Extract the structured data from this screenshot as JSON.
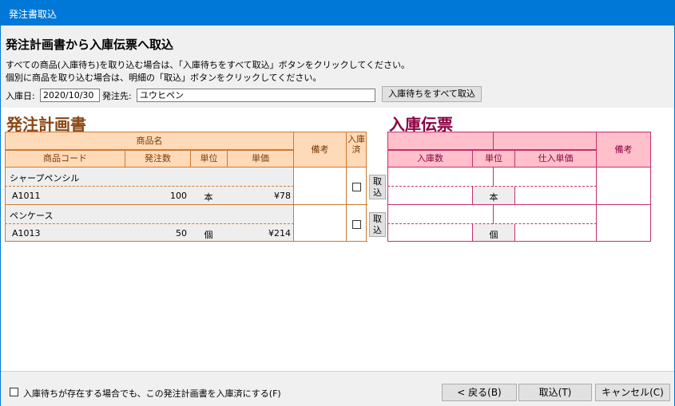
{
  "window": {
    "title": "発注書取込"
  },
  "header": {
    "heading": "発注計画書から入庫伝票へ取込",
    "desc1": "すべての商品(入庫待ち)を取り込む場合は、「入庫待ちをすべて取込」ボタンをクリックしてください。",
    "desc2": "個別に商品を取り込む場合は、明細の「取込」ボタンをクリックしてください。",
    "date_label": "入庫日:",
    "date_value": "2020/10/30",
    "supplier_label": "発注先:",
    "supplier_value": "ユウヒペン",
    "import_all_label": "入庫待ちをすべて取込"
  },
  "order": {
    "title": "発注計画書",
    "headers": {
      "product_name": "商品名",
      "product_code": "商品コード",
      "order_qty": "発注数",
      "unit": "単位",
      "unit_price": "単価",
      "remarks": "備考",
      "received": "入庫済"
    },
    "rows": [
      {
        "name": "シャープペンシル",
        "code": "A1011",
        "qty": "100",
        "unit": "本",
        "price": "¥78"
      },
      {
        "name": "ペンケース",
        "code": "A1013",
        "qty": "50",
        "unit": "個",
        "price": "¥214"
      }
    ]
  },
  "import_button": {
    "label": "取込"
  },
  "receipt": {
    "title": "入庫伝票",
    "headers": {
      "received_qty": "入庫数",
      "unit": "単位",
      "purchase_price": "仕入単価",
      "remarks": "備考"
    },
    "rows": [
      {
        "unit": "本"
      },
      {
        "unit": "個"
      }
    ]
  },
  "footer": {
    "checkbox_label": "入庫待ちが存在する場合でも、この発注計画書を入庫済にする(F)",
    "back_label": "< 戻る(B)",
    "import_label": "取込(T)",
    "cancel_label": "キャンセル(C)"
  },
  "colors": {
    "titlebar": "#0078d7",
    "order_accent": "#8b4513",
    "receipt_accent": "#8b0040"
  }
}
